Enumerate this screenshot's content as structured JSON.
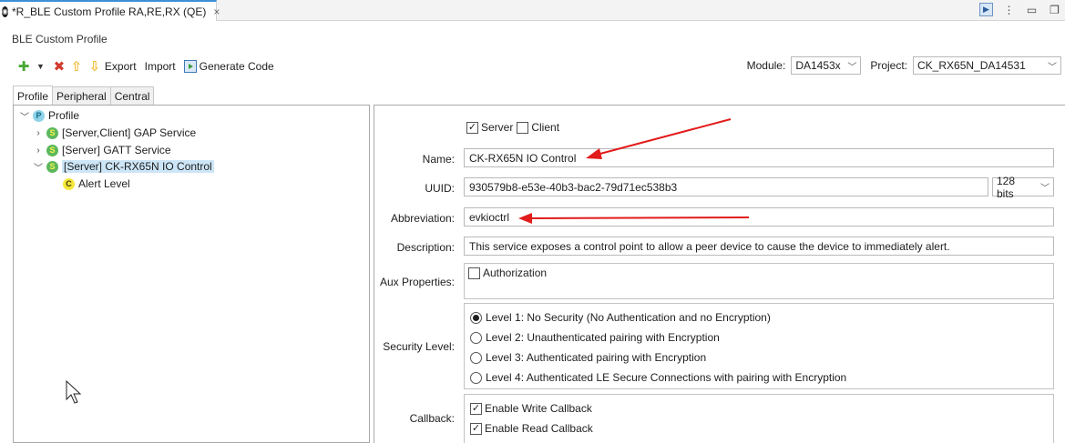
{
  "editor_tab": {
    "title": "*R_BLE Custom Profile RA,RE,RX (QE)",
    "close": "×"
  },
  "window_icons": {
    "app": "app-icon",
    "more": "⋮",
    "minimize": "▭",
    "restore": "❐"
  },
  "section_title": "BLE Custom Profile",
  "toolbar": {
    "add_icon": "✚",
    "dropdown_icon": "▼",
    "delete_icon": "✖",
    "up_icon": "⇧",
    "down_icon": "⇩",
    "export_label": "Export",
    "import_label": "Import",
    "generate_label": "Generate Code"
  },
  "module": {
    "label": "Module:",
    "value": "DA1453x"
  },
  "project": {
    "label": "Project:",
    "value": "CK_RX65N_DA14531"
  },
  "tabs": [
    "Profile",
    "Peripheral",
    "Central"
  ],
  "tree": {
    "root": {
      "badge": "P",
      "label": "Profile"
    },
    "items": [
      {
        "badge": "S",
        "label": "[Server,Client] GAP Service"
      },
      {
        "badge": "S",
        "label": "[Server] GATT Service"
      },
      {
        "badge": "S",
        "label": "[Server] CK-RX65N IO Control"
      }
    ],
    "child": {
      "badge": "C",
      "label": "Alert Level"
    }
  },
  "form": {
    "server_label": "Server",
    "client_label": "Client",
    "name_label": "Name:",
    "name_value": "CK-RX65N IO Control",
    "uuid_label": "UUID:",
    "uuid_value": "930579b8-e53e-40b3-bac2-79d71ec538b3",
    "uuid_bits": "128 bits",
    "abbreviation_label": "Abbreviation:",
    "abbreviation_value": "evkioctrl",
    "description_label": "Description:",
    "description_value": "This service exposes a control point to allow a peer device to cause the device to immediately alert.",
    "aux_label": "Aux Properties:",
    "aux_authorization": "Authorization",
    "security_label": "Security Level:",
    "security_options": [
      "Level 1: No Security (No Authentication and no Encryption)",
      "Level 2: Unauthenticated pairing with Encryption",
      "Level 3: Authenticated pairing with Encryption",
      "Level 4: Authenticated LE Secure Connections with pairing with Encryption"
    ],
    "callback_label": "Callback:",
    "callback_write": "Enable Write Callback",
    "callback_read": "Enable Read Callback"
  },
  "checkmark": "✓",
  "colors": {
    "accent": "#3c8fd8",
    "annotation_arrow": "#e21b1b",
    "selection": "#cde6f7"
  }
}
